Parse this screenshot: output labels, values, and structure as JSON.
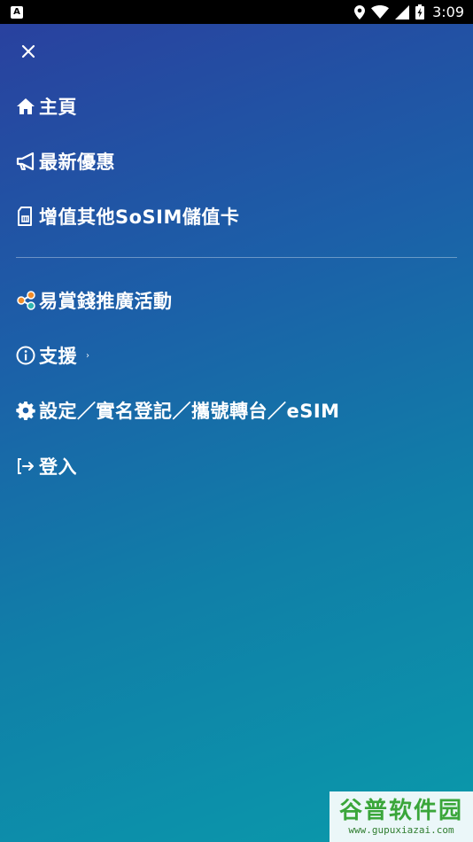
{
  "status_bar": {
    "notification_icon": "A",
    "time": "3:09",
    "icons": [
      "location-icon",
      "wifi-icon",
      "signal-icon",
      "battery-charging-icon"
    ]
  },
  "drawer": {
    "close_icon": "close-icon",
    "primary_items": [
      {
        "icon": "home-icon",
        "label": "主頁"
      },
      {
        "icon": "megaphone-icon",
        "label": "最新優惠"
      },
      {
        "icon": "sim-card-icon",
        "label": "增值其他SoSIM儲值卡"
      }
    ],
    "secondary_items": [
      {
        "icon": "share-icon",
        "label": "易賞錢推廣活動"
      },
      {
        "icon": "info-icon",
        "label": "支援",
        "chevron": "›"
      },
      {
        "icon": "gear-icon",
        "label": "設定／實名登記／攜號轉台／eSIM"
      },
      {
        "icon": "login-icon",
        "label": "登入"
      }
    ]
  },
  "watermark": {
    "logo": "谷普软件园",
    "url": "www.gupuxiazai.com"
  },
  "colors": {
    "gradient_start": "#2a3f9e",
    "gradient_end": "#0a9aab",
    "text": "#ffffff"
  }
}
